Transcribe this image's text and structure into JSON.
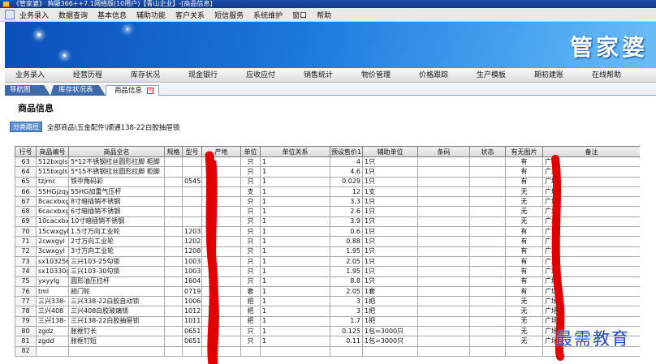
{
  "window": {
    "title": "《管家婆》  夠顯366++7.1网络版(10用户)【青山企业】-[商品信息]"
  },
  "menubar": {
    "items": [
      "业务录入",
      "数据查询",
      "基本信息",
      "辅助功能",
      "客户关系",
      "短信服务",
      "系统维护",
      "窗口",
      "帮助"
    ]
  },
  "banner": {
    "logo_text": "管家婆"
  },
  "modules": {
    "items": [
      "业务录入",
      "经营历程",
      "库存状况",
      "现金银行",
      "应收应付",
      "销售统计",
      "物价管理",
      "价格跟踪",
      "生产模板",
      "期初建账",
      "在线帮助"
    ]
  },
  "page_tabs": {
    "items": [
      "导航图",
      "库存状况表",
      "商品信息"
    ],
    "close_glyph": "×"
  },
  "page": {
    "title": "商品信息",
    "category_button": "分类路径",
    "category_path": "全部商品\\五金配件\\顺通138-22白胶抽屉锁"
  },
  "table": {
    "columns": [
      "行号",
      "商品编号",
      "商品全名",
      "规格",
      "型号",
      "产地",
      "单位",
      "单位关系",
      "预设售价1",
      "辅助单位",
      "条码",
      "状态",
      "有无图片",
      "备注"
    ],
    "rows": [
      [
        "63",
        "512bxgls",
        "5*12不锈钢拉丝圆形拉脚 柜脚",
        "",
        "",
        "",
        "只",
        "1",
        "4",
        "1只",
        "",
        "",
        "有",
        "广场"
      ],
      [
        "64",
        "515bxgls",
        "5*15不锈钢拉丝圆形拉脚 柜脚",
        "",
        "",
        "",
        "只",
        "1",
        "4.6",
        "1只",
        "",
        "",
        "有",
        "广场"
      ],
      [
        "65",
        "tzjmc",
        "铁中角码彩",
        "",
        "0545",
        "",
        "只",
        "1",
        "0.029",
        "1只",
        "",
        "",
        "有",
        "广场"
      ],
      [
        "66",
        "55HGjzqy",
        "55HG加重气压杆",
        "",
        "",
        "",
        "支",
        "1",
        "12",
        "1支",
        "",
        "",
        "无",
        "广场"
      ],
      [
        "67",
        "8cacxbxg",
        "8寸暗插销不锈钢",
        "",
        "",
        "",
        "只",
        "1",
        "3.3",
        "1只",
        "",
        "",
        "无",
        "广场"
      ],
      [
        "68",
        "6cacxbxg",
        "6寸暗插销不锈钢",
        "",
        "",
        "",
        "只",
        "1",
        "2.6",
        "1只",
        "",
        "",
        "无",
        "广场"
      ],
      [
        "69",
        "10cacxbx",
        "10寸暗插销不锈钢",
        "",
        "",
        "",
        "只",
        "1",
        "3.9",
        "1只",
        "",
        "",
        "无",
        "广场"
      ],
      [
        "70",
        "15cwxgyl",
        "1.5寸万向工业轮",
        "",
        "1203",
        "",
        "只",
        "1",
        "0.6",
        "1只",
        "",
        "",
        "有",
        "广场"
      ],
      [
        "71",
        "2cwxgyl",
        "2寸万向工业轮",
        "",
        "1202",
        "",
        "只",
        "1",
        "0.88",
        "1只",
        "",
        "",
        "有",
        "广场"
      ],
      [
        "72",
        "3cwxgyl",
        "3寸万向工业轮",
        "",
        "1208",
        "",
        "只",
        "1",
        "1.95",
        "1只",
        "",
        "",
        "有",
        "广场"
      ],
      [
        "73",
        "sx103256",
        "三兴103-25勾锁",
        "",
        "1003",
        "",
        "只",
        "1",
        "2.05",
        "1只",
        "",
        "",
        "有",
        "广场"
      ],
      [
        "74",
        "sx10330g",
        "三兴103-30勾锁",
        "",
        "1003",
        "",
        "只",
        "1",
        "1.95",
        "1只",
        "",
        "",
        "有",
        "广场"
      ],
      [
        "75",
        "yxyylg",
        "圆形油压拉杆",
        "",
        "1604",
        "",
        "只",
        "1",
        "8.8",
        "1只",
        "",
        "",
        "有",
        "广场"
      ],
      [
        "76",
        "tml",
        "趟门轮",
        "",
        "0719",
        "",
        "套",
        "1",
        "2.05",
        "1套",
        "",
        "",
        "有",
        "广场"
      ],
      [
        "77",
        "三兴338-",
        "三兴338-22白胶自动锁",
        "",
        "1006",
        "",
        "把",
        "1",
        "3",
        "1把",
        "",
        "",
        "无",
        "广场"
      ],
      [
        "78",
        "三兴408",
        "三兴408白胶玻璃锁",
        "",
        "1012",
        "",
        "把",
        "1",
        "3",
        "1把",
        "",
        "",
        "无",
        "广场"
      ],
      [
        "79",
        "三兴138-",
        "三兴138-22白胶抽屉锁",
        "",
        "1011",
        "",
        "把",
        "1",
        "1.7",
        "1把",
        "",
        "",
        "无",
        "广场"
      ],
      [
        "80",
        "zgdz",
        "胀框钉长",
        "",
        "0651",
        "",
        "只",
        "1",
        "0.125",
        "1包=3000只",
        "",
        "",
        "无",
        "广场"
      ],
      [
        "81",
        "zgdd",
        "胀框钉短",
        "",
        "0651",
        "",
        "只",
        "1",
        "0.11",
        "1包=3000只",
        "",
        "",
        "无",
        "广场"
      ],
      [
        "82",
        "",
        "",
        "",
        "",
        "",
        "",
        "",
        "",
        "",
        "",
        "",
        "",
        ""
      ]
    ]
  },
  "watermark": {
    "text": "最需教育"
  },
  "colors": {
    "titlebar": "#1d4fb0",
    "banner": "#1b77dc",
    "redaction": "#e00000",
    "watermark": "#2048c8"
  }
}
